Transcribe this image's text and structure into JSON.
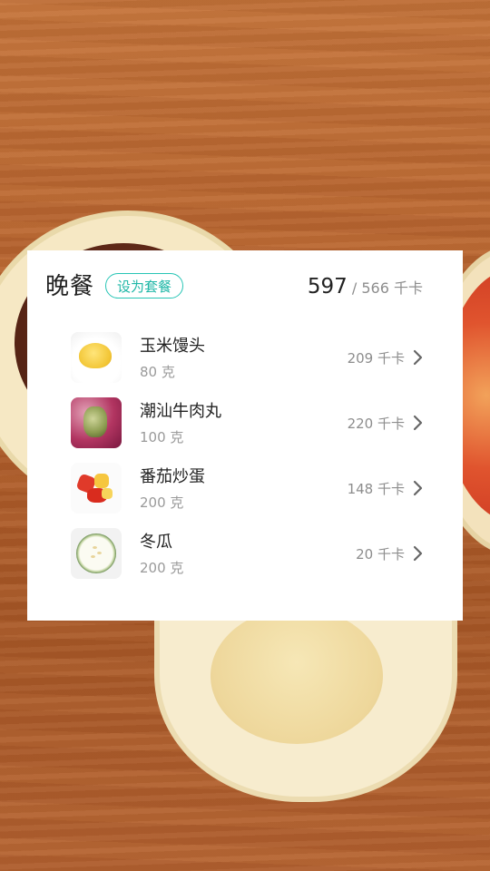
{
  "meal": {
    "title": "晚餐",
    "preset_button": "设为套餐",
    "calories_eaten": "597",
    "separator": "/",
    "calories_target": "566",
    "calories_unit": "千卡"
  },
  "foods": [
    {
      "name": "玉米馒头",
      "amount": "80 克",
      "calories": "209 千卡",
      "thumbnail": "corn-bun"
    },
    {
      "name": "潮汕牛肉丸",
      "amount": "100 克",
      "calories": "220 千卡",
      "thumbnail": "beef-ball"
    },
    {
      "name": "番茄炒蛋",
      "amount": "200 克",
      "calories": "148 千卡",
      "thumbnail": "tomato-egg"
    },
    {
      "name": "冬瓜",
      "amount": "200 克",
      "calories": "20 千卡",
      "thumbnail": "winter-melon"
    }
  ],
  "icons": {
    "row_action": "chevron-right-icon"
  },
  "colors": {
    "accent": "#27c5b5",
    "card_bg": "#ffffff",
    "table": "#b4622c"
  }
}
